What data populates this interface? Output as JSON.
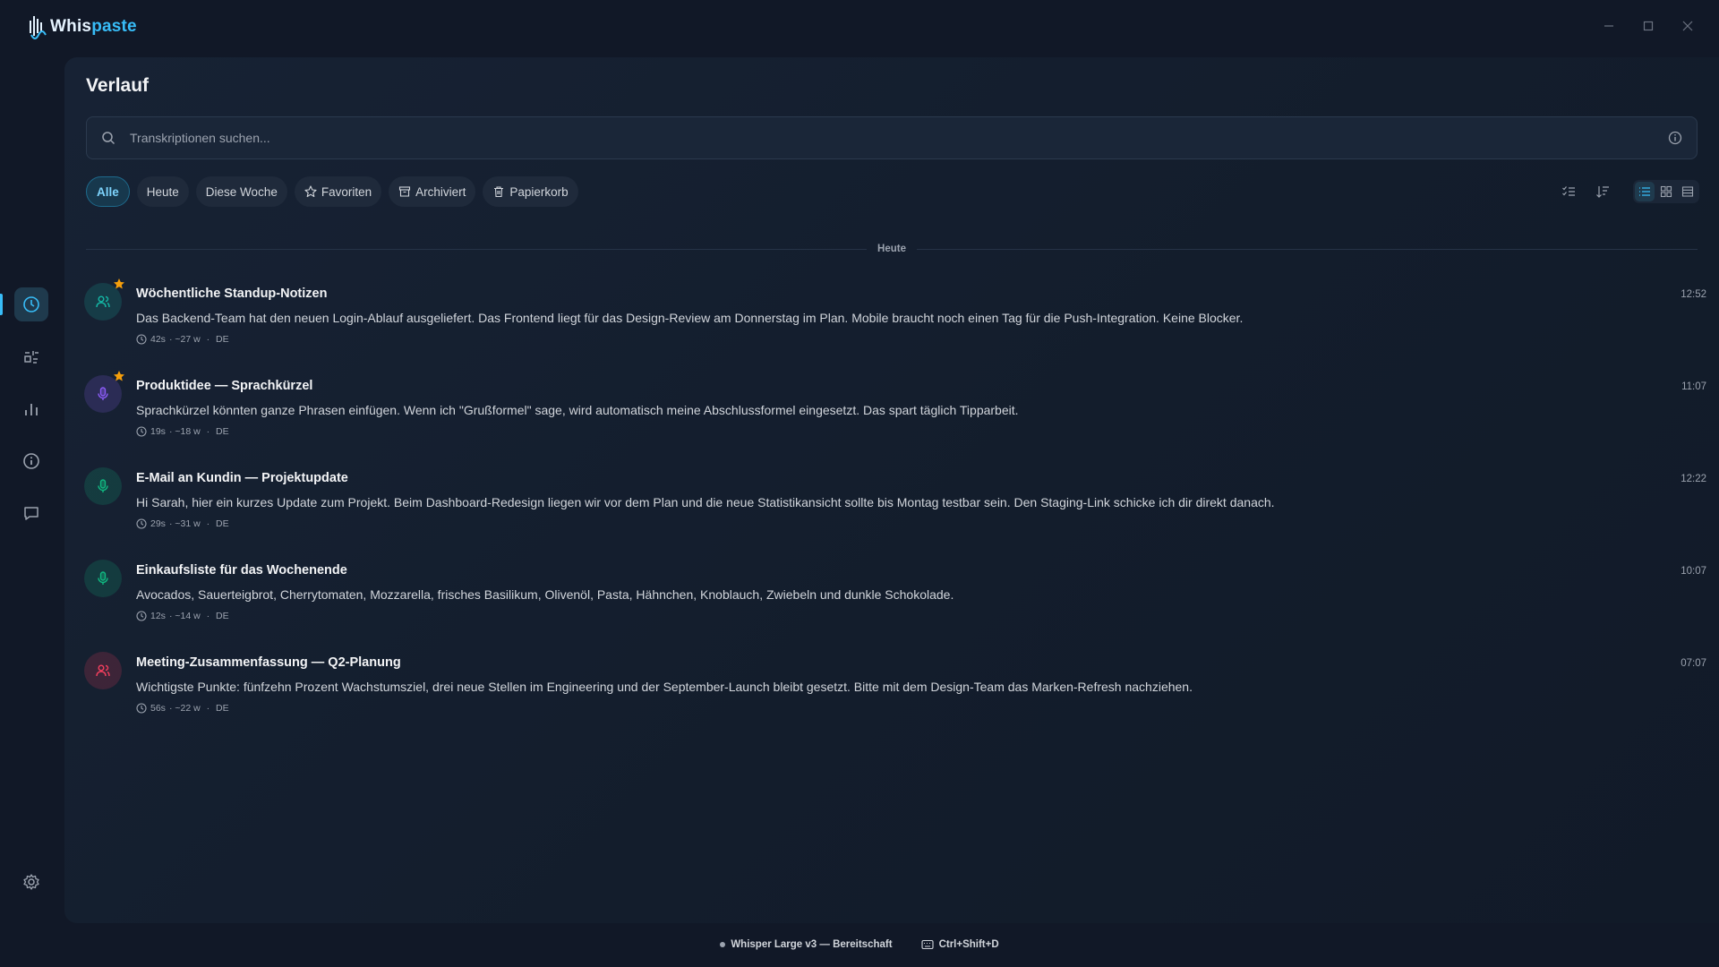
{
  "app": {
    "name_prefix": "Whis",
    "name_suffix": "paste"
  },
  "window_controls": [
    "minimize-icon",
    "maximize-icon",
    "close-icon"
  ],
  "sidebar": {
    "items": [
      {
        "name": "history",
        "icon": "clock-icon",
        "active": true
      },
      {
        "name": "snippets",
        "icon": "snippets-icon",
        "active": false
      },
      {
        "name": "statistics",
        "icon": "bar-chart-icon",
        "active": false
      },
      {
        "name": "info",
        "icon": "info-icon",
        "active": false
      },
      {
        "name": "feedback",
        "icon": "message-icon",
        "active": false
      }
    ],
    "bottom": {
      "name": "settings",
      "icon": "gear-icon"
    }
  },
  "page": {
    "title": "Verlauf"
  },
  "search": {
    "placeholder": "Transkriptionen suchen..."
  },
  "filters": [
    {
      "label": "Alle",
      "active": true
    },
    {
      "label": "Heute",
      "active": false
    },
    {
      "label": "Diese Woche",
      "active": false
    },
    {
      "label": "Favoriten",
      "icon": "star-icon",
      "active": false
    },
    {
      "label": "Archiviert",
      "icon": "archive-icon",
      "active": false
    },
    {
      "label": "Papierkorb",
      "icon": "trash-icon",
      "active": false
    }
  ],
  "group_label": "Heute",
  "entries": [
    {
      "title": "Wöchentliche Standup-Notizen",
      "text": "Das Backend-Team hat den neuen Login-Ablauf ausgeliefert. Das Frontend liegt für das Design-Review am Donnerstag im Plan. Mobile braucht noch einen Tag für die Push-Integration. Keine Blocker.",
      "duration": "42s",
      "words": "· ~27 w",
      "lang": "DE",
      "time": "12:52",
      "favorite": true,
      "icon": "users-icon",
      "color": "#14b8a6"
    },
    {
      "title": "Produktidee — Sprachkürzel",
      "text": "Sprachkürzel könnten ganze Phrasen einfügen. Wenn ich \"Grußformel\" sage, wird automatisch meine Abschlussformel eingesetzt. Das spart täglich Tipparbeit.",
      "duration": "19s",
      "words": "· ~18 w",
      "lang": "DE",
      "time": "11:07",
      "favorite": true,
      "icon": "microphone-icon",
      "color": "#8b5cf6"
    },
    {
      "title": "E-Mail an Kundin — Projektupdate",
      "text": "Hi Sarah, hier ein kurzes Update zum Projekt. Beim Dashboard-Redesign liegen wir vor dem Plan und die neue Statistikansicht sollte bis Montag testbar sein. Den Staging-Link schicke ich dir direkt danach.",
      "duration": "29s",
      "words": "· ~31 w",
      "lang": "DE",
      "time": "12:22",
      "favorite": false,
      "icon": "microphone-icon",
      "color": "#10b981"
    },
    {
      "title": "Einkaufsliste für das Wochenende",
      "text": "Avocados, Sauerteigbrot, Cherrytomaten, Mozzarella, frisches Basilikum, Olivenöl, Pasta, Hähnchen, Knoblauch, Zwiebeln und dunkle Schokolade.",
      "duration": "12s",
      "words": "· ~14 w",
      "lang": "DE",
      "time": "10:07",
      "favorite": false,
      "icon": "microphone-icon",
      "color": "#10b981"
    },
    {
      "title": "Meeting-Zusammenfassung — Q2-Planung",
      "text": "Wichtigste Punkte: fünfzehn Prozent Wachstumsziel, drei neue Stellen im Engineering und der September-Launch bleibt gesetzt. Bitte mit dem Design-Team das Marken-Refresh nachziehen.",
      "duration": "56s",
      "words": "· ~22 w",
      "lang": "DE",
      "time": "07:07",
      "favorite": false,
      "icon": "users-icon",
      "color": "#f43f5e"
    }
  ],
  "statusbar": {
    "model": "Whisper Large v3 — Bereitschaft",
    "shortcut": "Ctrl+Shift+D"
  },
  "colors": {
    "accent": "#38bdf8",
    "star": "#f59e0b",
    "background": "#111827"
  }
}
